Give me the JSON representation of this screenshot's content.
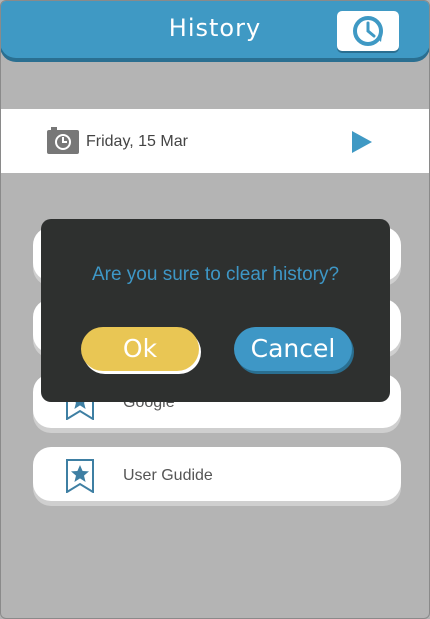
{
  "header": {
    "title": "History",
    "history_icon": "clock-icon"
  },
  "date_bar": {
    "date": "Friday, 15 Mar",
    "calendar_icon": "calendar-clock-icon",
    "next_icon": "play-arrow-icon"
  },
  "list": {
    "items": [
      {
        "label": "",
        "icon": "bookmark-star-icon"
      },
      {
        "label": "",
        "icon": "bookmark-star-icon"
      },
      {
        "label": "Google",
        "icon": "bookmark-star-icon"
      },
      {
        "label": "User Gudide",
        "icon": "bookmark-star-icon"
      }
    ]
  },
  "dialog": {
    "message": "Are you sure to clear history?",
    "ok_label": "Ok",
    "cancel_label": "Cancel"
  },
  "colors": {
    "accent": "#3f99c4",
    "ok": "#e9c654",
    "dialog_bg": "#2e302f",
    "overlay": "#b4b4b4"
  }
}
